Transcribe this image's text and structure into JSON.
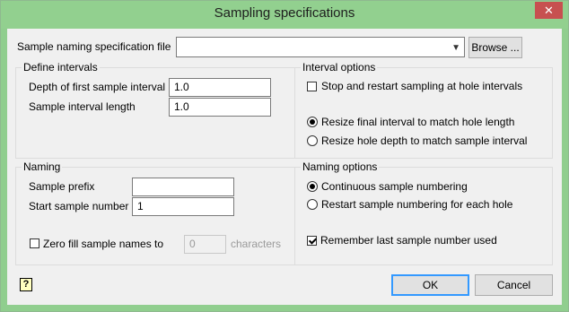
{
  "window": {
    "title": "Sampling specifications",
    "close_label": "✕"
  },
  "spec_file": {
    "label": "Sample naming specification file",
    "value": "",
    "browse_label": "Browse ..."
  },
  "define_intervals": {
    "title": "Define intervals",
    "depth_label": "Depth of first sample interval",
    "depth_value": "1.0",
    "length_label": "Sample interval length",
    "length_value": "1.0"
  },
  "interval_options": {
    "title": "Interval options",
    "stop_restart_label": "Stop and restart sampling at hole intervals",
    "stop_restart_checked": false,
    "resize_final_label": "Resize final interval to match hole length",
    "resize_depth_label": "Resize hole depth to match sample interval",
    "selected": "resize_final"
  },
  "naming": {
    "title": "Naming",
    "prefix_label": "Sample prefix",
    "prefix_value": "",
    "start_label": "Start sample number",
    "start_value": "1",
    "zero_fill_label": "Zero fill sample names to",
    "zero_fill_checked": false,
    "zero_fill_value": "0",
    "characters_label": "characters"
  },
  "naming_options": {
    "title": "Naming options",
    "continuous_label": "Continuous sample numbering",
    "restart_label": "Restart sample numbering for each hole",
    "selected": "continuous",
    "remember_label": "Remember last sample number used",
    "remember_checked": true
  },
  "footer": {
    "help_icon": "?",
    "ok_label": "OK",
    "cancel_label": "Cancel"
  }
}
